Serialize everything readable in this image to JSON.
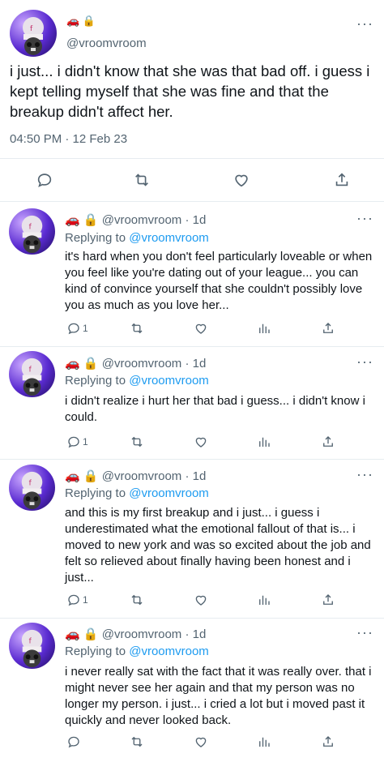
{
  "main_tweet": {
    "handle": "@vroomvroom",
    "badges": [
      "🚗",
      "🔒"
    ],
    "text": "i just... i didn't know that she was that bad off. i guess i kept telling myself that she was fine and that the breakup didn't affect her.",
    "timestamp": "04:50 PM · 12 Feb 23",
    "more": "···",
    "actions": [
      "reply-icon",
      "retweet-icon",
      "like-icon",
      "share-icon"
    ]
  },
  "replies": [
    {
      "handle": "@vroomvroom",
      "time": "1d",
      "replying_prefix": "Replying to ",
      "replying_to": "@vroomvroom",
      "text": "it's hard when you don't feel particularly loveable or when you feel like you're dating out of your league... you can kind of convince yourself that she couldn't possibly love you as much as you love her...",
      "reply_count": "1"
    },
    {
      "handle": "@vroomvroom",
      "time": "1d",
      "replying_prefix": "Replying to ",
      "replying_to": "@vroomvroom",
      "text": "i didn't realize i hurt her that bad i guess... i didn't know i could.",
      "reply_count": "1"
    },
    {
      "handle": "@vroomvroom",
      "time": "1d",
      "replying_prefix": "Replying to ",
      "replying_to": "@vroomvroom",
      "text": "and this is my first breakup and i just... i guess i underestimated what the emotional fallout of that is... i moved to new york and was so excited about the job and felt so relieved about finally having been honest and i just...",
      "reply_count": "1"
    },
    {
      "handle": "@vroomvroom",
      "time": "1d",
      "replying_prefix": "Replying to ",
      "replying_to": "@vroomvroom",
      "text": "i never really sat with the fact that it was really over. that i might never see her again and that my person was no longer my person. i just... i cried a lot but i moved past it quickly and never looked back.",
      "reply_count": ""
    }
  ],
  "colors": {
    "muted": "#536471",
    "link": "#1d9bf0",
    "text": "#0f1419",
    "divider": "#e6ecf0"
  }
}
